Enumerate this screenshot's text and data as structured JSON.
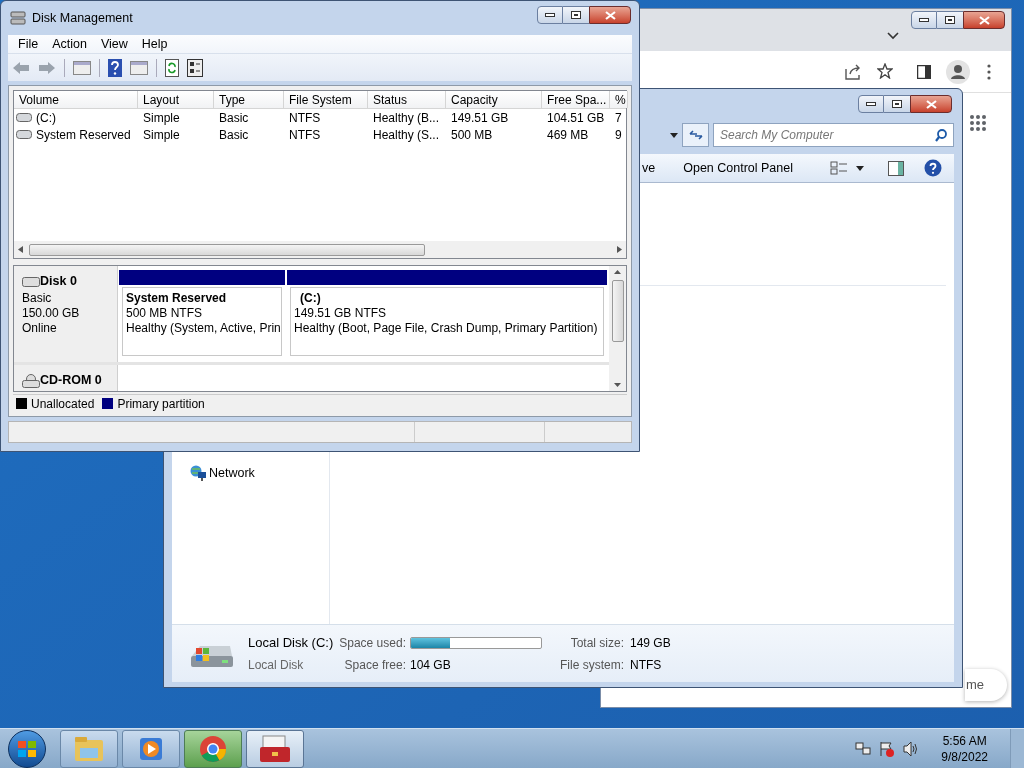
{
  "disk_management": {
    "title": "Disk Management",
    "menu": [
      "File",
      "Action",
      "View",
      "Help"
    ],
    "volume_list": {
      "columns": [
        "Volume",
        "Layout",
        "Type",
        "File System",
        "Status",
        "Capacity",
        "Free Spa...",
        "%"
      ],
      "rows": [
        {
          "kind": "volume",
          "cells": [
            "(C:)",
            "Simple",
            "Basic",
            "NTFS",
            "Healthy (B...",
            "149.51 GB",
            "104.51 GB",
            "7"
          ]
        },
        {
          "kind": "volume",
          "cells": [
            "System Reserved",
            "Simple",
            "Basic",
            "NTFS",
            "Healthy (S...",
            "500 MB",
            "469 MB",
            "9"
          ]
        }
      ]
    },
    "disks": [
      {
        "kind": "disk",
        "name": "Disk 0",
        "lines": [
          "Basic",
          "150.00 GB",
          "Online"
        ],
        "partitions": [
          {
            "name": "System Reserved",
            "detail": "500 MB NTFS",
            "status": "Healthy (System, Active, Prin",
            "color": "#000080"
          },
          {
            "name": "(C:)",
            "detail": "149.51 GB NTFS",
            "status": "Healthy (Boot, Page File, Crash Dump, Primary Partition)",
            "color": "#000080"
          }
        ]
      },
      {
        "kind": "cdrom",
        "name": "CD-ROM 0"
      }
    ],
    "legend": [
      {
        "label": "Unallocated",
        "color": "#000000"
      },
      {
        "label": "Primary partition",
        "color": "#000080"
      }
    ]
  },
  "explorer": {
    "search": {
      "placeholder": "Search My Computer"
    },
    "commands": [
      "ve",
      "Open Control Panel"
    ],
    "nav": [
      "Network"
    ],
    "details": {
      "name": "Local Disk (C:)",
      "type": "Local Disk",
      "used_label": "Space used:",
      "level": 0.3,
      "free_label": "Space free:",
      "free": "104 GB",
      "total_label": "Total size:",
      "total": "149 GB",
      "fs_label": "File system:",
      "fs": "NTFS"
    }
  },
  "browser": {
    "partial_button": "me"
  },
  "taskbar": {
    "items": [
      {
        "kind": "folder",
        "selected": false
      },
      {
        "kind": "media",
        "selected": false
      },
      {
        "kind": "chrome",
        "selected": false
      },
      {
        "kind": "toolbox",
        "selected": true
      }
    ],
    "time": "5:56 AM",
    "date": "9/8/2022"
  }
}
